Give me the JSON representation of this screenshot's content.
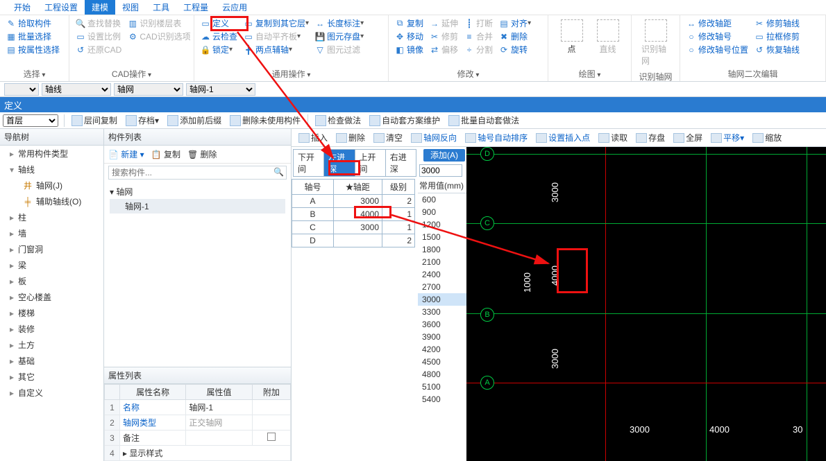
{
  "tabs": [
    "开始",
    "工程设置",
    "建模",
    "视图",
    "工具",
    "工程量",
    "云应用"
  ],
  "active_tab": 2,
  "ribbon": {
    "g1": {
      "items": [
        "拾取构件",
        "批量选择",
        "按属性选择"
      ],
      "footer": "选择",
      "dd": true
    },
    "g2": {
      "row1": [
        "查找替换",
        "识别楼层表"
      ],
      "row2": [
        "设置比例",
        "CAD识别选项"
      ],
      "row3": [
        "还原CAD"
      ],
      "footer": "CAD操作",
      "dd": true
    },
    "g3": {
      "items": [
        "定义",
        "云检查",
        "锁定"
      ],
      "row2": [
        "复制到其它层",
        "自动平齐板",
        "两点辅轴"
      ],
      "row3": [
        "长度标注",
        "图元存盘",
        "图元过滤"
      ],
      "footer": "通用操作",
      "dd": true
    },
    "g4": {
      "row1": [
        "复制",
        "延伸",
        "打断",
        "对齐"
      ],
      "row2": [
        "移动",
        "修剪",
        "合并",
        "删除"
      ],
      "row3": [
        "镜像",
        "偏移",
        "分割",
        "旋转"
      ],
      "footer": "修改",
      "dd": true
    },
    "g5": {
      "items": [
        "点",
        "直线",
        "识别轴网"
      ],
      "footer": "绘图",
      "extra": "识别轴网"
    },
    "g6": {
      "row1": [
        "修改轴距",
        "修剪轴线"
      ],
      "row2": [
        "修改轴号",
        "拉框修剪"
      ],
      "row3": [
        "修改轴号位置",
        "恢复轴线"
      ],
      "footer": "轴网二次编辑"
    }
  },
  "selrow": {
    "a": "",
    "b": "轴线",
    "c": "轴网",
    "d": "轴网-1"
  },
  "bluebar": "定义",
  "tb2": {
    "floor": "首层",
    "items": [
      "层间复制",
      "存档",
      "添加前后缀",
      "删除未使用构件",
      "检查做法",
      "自动套方案维护",
      "批量自动套做法"
    ]
  },
  "nav": {
    "title": "导航树",
    "root0": "常用构件类型",
    "root1": "轴线",
    "sub": [
      {
        "icon": "grid",
        "label": "轴网(J)"
      },
      {
        "icon": "aux",
        "label": "辅助轴线(O)"
      }
    ],
    "rest": [
      "柱",
      "墙",
      "门窗洞",
      "梁",
      "板",
      "空心楼盖",
      "楼梯",
      "装修",
      "土方",
      "基础",
      "其它",
      "自定义"
    ]
  },
  "comp": {
    "title": "构件列表",
    "bar": [
      "新建",
      "复制",
      "删除"
    ],
    "search_ph": "搜索构件...",
    "treeRoot": "轴网",
    "treeItem": "轴网-1",
    "propTitle": "属性列表",
    "propHead": [
      "属性名称",
      "属性值",
      "附加"
    ],
    "propRows": [
      {
        "n": "1",
        "k": "名称",
        "v": "轴网-1",
        "blue": true
      },
      {
        "n": "2",
        "k": "轴网类型",
        "v": "正交轴网",
        "blue": true,
        "grey": true
      },
      {
        "n": "3",
        "k": "备注",
        "v": "",
        "chk": true
      },
      {
        "n": "4",
        "k": "显示样式",
        "v": "",
        "tgl": true
      }
    ]
  },
  "cbar": [
    "插入",
    "删除",
    "清空",
    "轴网反向",
    "轴号自动排序",
    "设置插入点",
    "读取",
    "存盘",
    "全屏",
    "平移",
    "缩放"
  ],
  "gridtabs": [
    "下开间",
    "左进深",
    "上开间",
    "右进深"
  ],
  "gridActive": 1,
  "addBtn": "添加(A)",
  "gridHead": [
    "轴号",
    "轴距",
    "级别"
  ],
  "gridRows": [
    {
      "a": "A",
      "d": "3000",
      "l": "2"
    },
    {
      "a": "B",
      "d": "4000",
      "l": "1"
    },
    {
      "a": "C",
      "d": "3000",
      "l": "1"
    },
    {
      "a": "D",
      "d": "",
      "l": "2"
    }
  ],
  "commonInput": "3000",
  "commonCap": "常用值(mm)",
  "commonVals": [
    "600",
    "900",
    "1200",
    "1500",
    "1800",
    "2100",
    "2400",
    "2700",
    "3000",
    "3300",
    "3600",
    "3900",
    "4200",
    "4500",
    "4800",
    "5100",
    "5400"
  ],
  "commonSel": "3000",
  "canvas": {
    "bubbles": [
      "A",
      "B",
      "C",
      "D"
    ],
    "vdims": [
      "3000",
      "4000",
      "3000",
      "1000"
    ],
    "hdims": [
      "3000",
      "4000",
      "30"
    ]
  }
}
